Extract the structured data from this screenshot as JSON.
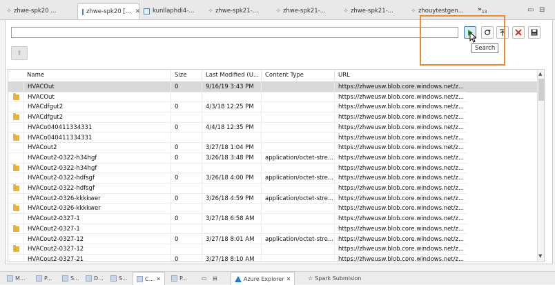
{
  "tabs": [
    {
      "label": "zhwe-spk20 ...",
      "active": false
    },
    {
      "label": "zhwe-spk20 [...",
      "active": true
    },
    {
      "label": "kunllaphdi4-...",
      "active": false
    },
    {
      "label": "zhwe-spk21-...",
      "active": false
    },
    {
      "label": "zhwe-spk21-...",
      "active": false
    },
    {
      "label": "zhwe-spk21-...",
      "active": false
    },
    {
      "label": "zhouytestgen...",
      "active": false
    }
  ],
  "overflow": {
    "label": "»",
    "count": "13"
  },
  "window_controls": {
    "minimize": "▭",
    "maximize": "⊟"
  },
  "search": {
    "value": "",
    "tooltip": "Search"
  },
  "toolbar": {
    "search_icon": "play-triangle-icon",
    "refresh_icon": "refresh-icon",
    "upload_icon": "upload-icon",
    "delete_icon": "delete-x-icon",
    "save_icon": "save-icon",
    "up_icon": "up-arrow-icon",
    "delete_color": "#d32f2f",
    "play_color": "#2e9b3f"
  },
  "highlight_color": "#f08a30",
  "table": {
    "columns": [
      "Name",
      "Size",
      "Last Modified (U...",
      "Content Type",
      "URL"
    ],
    "rows": [
      {
        "folder": false,
        "name": "HVACOut",
        "size": "0",
        "modified": "9/16/19 3:43 PM",
        "type": "",
        "url": "https://zhweusw.blob.core.windows.net/z...",
        "selected": true
      },
      {
        "folder": true,
        "name": "HVACOut",
        "size": "",
        "modified": "",
        "type": "",
        "url": "https://zhweusw.blob.core.windows.net/z..."
      },
      {
        "folder": false,
        "name": "HVACdfgut2",
        "size": "0",
        "modified": "4/3/18 12:25 PM",
        "type": "",
        "url": "https://zhweusw.blob.core.windows.net/z..."
      },
      {
        "folder": true,
        "name": "HVACdfgut2",
        "size": "",
        "modified": "",
        "type": "",
        "url": "https://zhweusw.blob.core.windows.net/z..."
      },
      {
        "folder": false,
        "name": "HVACo040411334331",
        "size": "0",
        "modified": "4/4/18 12:35 PM",
        "type": "",
        "url": "https://zhweusw.blob.core.windows.net/z..."
      },
      {
        "folder": true,
        "name": "HVACo040411334331",
        "size": "",
        "modified": "",
        "type": "",
        "url": "https://zhweusw.blob.core.windows.net/z..."
      },
      {
        "folder": false,
        "name": "HVACout2",
        "size": "0",
        "modified": "3/27/18 1:04 PM",
        "type": "",
        "url": "https://zhweusw.blob.core.windows.net/z..."
      },
      {
        "folder": false,
        "name": "HVACout2-0322-h34hgf",
        "size": "0",
        "modified": "3/26/18 3:48 PM",
        "type": "application/octet-stre...",
        "url": "https://zhweusw.blob.core.windows.net/z..."
      },
      {
        "folder": true,
        "name": "HVACout2-0322-h34hgf",
        "size": "",
        "modified": "",
        "type": "",
        "url": "https://zhweusw.blob.core.windows.net/z..."
      },
      {
        "folder": false,
        "name": "HVACout2-0322-hdfsgf",
        "size": "0",
        "modified": "3/26/18 4:00 PM",
        "type": "application/octet-stre...",
        "url": "https://zhweusw.blob.core.windows.net/z..."
      },
      {
        "folder": true,
        "name": "HVACout2-0322-hdfsgf",
        "size": "",
        "modified": "",
        "type": "",
        "url": "https://zhweusw.blob.core.windows.net/z..."
      },
      {
        "folder": false,
        "name": "HVACout2-0326-kkkkwer",
        "size": "0",
        "modified": "3/26/18 4:59 PM",
        "type": "application/octet-stre...",
        "url": "https://zhweusw.blob.core.windows.net/z..."
      },
      {
        "folder": true,
        "name": "HVACout2-0326-kkkkwer",
        "size": "",
        "modified": "",
        "type": "",
        "url": "https://zhweusw.blob.core.windows.net/z..."
      },
      {
        "folder": false,
        "name": "HVACout2-0327-1",
        "size": "0",
        "modified": "3/27/18 6:58 AM",
        "type": "",
        "url": "https://zhweusw.blob.core.windows.net/z..."
      },
      {
        "folder": true,
        "name": "HVACout2-0327-1",
        "size": "",
        "modified": "",
        "type": "",
        "url": "https://zhweusw.blob.core.windows.net/z..."
      },
      {
        "folder": false,
        "name": "HVACout2-0327-12",
        "size": "0",
        "modified": "3/27/18 8:01 AM",
        "type": "application/octet-stre...",
        "url": "https://zhweusw.blob.core.windows.net/z..."
      },
      {
        "folder": true,
        "name": "HVACout2-0327-12",
        "size": "",
        "modified": "",
        "type": "",
        "url": "https://zhweusw.blob.core.windows.net/z..."
      },
      {
        "folder": false,
        "name": "HVACout2-0327-21",
        "size": "0",
        "modified": "3/27/18 8:10 AM",
        "type": "",
        "url": "https://zhweusw.blob.core.windows.net/z..."
      }
    ]
  },
  "bottom_tabs": [
    {
      "label": "M..."
    },
    {
      "label": "P..."
    },
    {
      "label": "S..."
    },
    {
      "label": "D..."
    },
    {
      "label": "S..."
    },
    {
      "label": "C..."
    },
    {
      "label": "P..."
    }
  ],
  "azure_explorer": {
    "label": "Azure Explorer"
  },
  "spark_submission": {
    "label": "Spark Submision"
  }
}
